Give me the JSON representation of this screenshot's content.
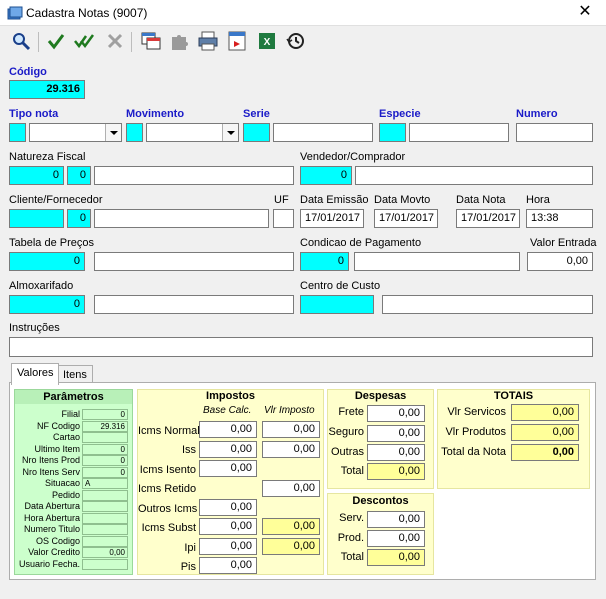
{
  "window": {
    "title": "Cadastra Notas (9007)",
    "close_glyph": "✕"
  },
  "toolbar": {
    "icons": [
      "search-icon",
      "check-icon",
      "check-all-icon",
      "cancel-icon",
      "copy-window-icon",
      "puzzle-icon",
      "print-icon",
      "pdf-icon",
      "excel-icon",
      "history-icon"
    ]
  },
  "header": {
    "codigo_label": "Código",
    "codigo_value": "29.316",
    "tipo_nota_label": "Tipo nota",
    "movimento_label": "Movimento",
    "serie_label": "Serie",
    "especie_label": "Especie",
    "numero_label": "Numero"
  },
  "natureza": {
    "label": "Natureza Fiscal",
    "code1": "0",
    "code2": "0"
  },
  "vendedor": {
    "label": "Vendedor/Comprador",
    "code": "0"
  },
  "cliente": {
    "label": "Cliente/Fornecedor",
    "code": "0",
    "uf_label": "UF"
  },
  "datas": {
    "emissao_label": "Data Emissão",
    "emissao_value": "17/01/2017",
    "movto_label": "Data Movto",
    "movto_value": "17/01/2017",
    "nota_label": "Data Nota",
    "nota_value": "17/01/2017",
    "hora_label": "Hora",
    "hora_value": "13:38"
  },
  "tabela": {
    "label": "Tabela de Preços",
    "code": "0"
  },
  "condicao": {
    "label": "Condicao de Pagamento",
    "code": "0"
  },
  "valor_entrada": {
    "label": "Valor Entrada",
    "value": "0,00"
  },
  "almoxarifado": {
    "label": "Almoxarifado",
    "code": "0"
  },
  "centro_custo": {
    "label": "Centro de Custo"
  },
  "instrucoes": {
    "label": "Instruções"
  },
  "tabs": [
    {
      "label": "Valores"
    },
    {
      "label": "Itens"
    }
  ],
  "parametros": {
    "title": "Parâmetros",
    "rows": [
      {
        "label": "Filial",
        "value": "0"
      },
      {
        "label": "NF Codigo",
        "value": "29.316"
      },
      {
        "label": "Cartao",
        "value": ""
      },
      {
        "label": "Ultimo Item",
        "value": "0"
      },
      {
        "label": "Nro Itens Prod",
        "value": "0"
      },
      {
        "label": "Nro Itens Serv",
        "value": "0"
      },
      {
        "label": "Situacao",
        "value": "A"
      },
      {
        "label": "Pedido",
        "value": ""
      },
      {
        "label": "Data Abertura",
        "value": ""
      },
      {
        "label": "Hora Abertura",
        "value": ""
      },
      {
        "label": "Numero Titulo",
        "value": ""
      },
      {
        "label": "OS Codigo",
        "value": ""
      },
      {
        "label": "Valor Credito",
        "value": "0,00"
      },
      {
        "label": "Usuario Fecha.",
        "value": ""
      }
    ]
  },
  "impostos": {
    "title": "Impostos",
    "col1": "Base Calc.",
    "col2": "Vlr Imposto",
    "icms_normal_label": "Icms Normal",
    "icms_normal_base": "0,00",
    "icms_normal_vlr": "0,00",
    "iss_label": "Iss",
    "iss_base": "0,00",
    "iss_vlr": "0,00",
    "icms_isento_label": "Icms Isento",
    "icms_isento_base": "0,00",
    "icms_retido_label": "Icms Retido",
    "icms_retido_vlr": "0,00",
    "outros_icms_label": "Outros Icms",
    "outros_icms_base": "0,00",
    "icms_subst_label": "Icms Subst",
    "icms_subst_base": "0,00",
    "icms_subst_vlr": "0,00",
    "ipi_label": "Ipi",
    "ipi_base": "0,00",
    "ipi_vlr": "0,00",
    "pis_label": "Pis",
    "pis_base": "0,00"
  },
  "despesas": {
    "title": "Despesas",
    "frete_label": "Frete",
    "frete_value": "0,00",
    "seguro_label": "Seguro",
    "seguro_value": "0,00",
    "outras_label": "Outras",
    "outras_value": "0,00",
    "total_label": "Total",
    "total_value": "0,00"
  },
  "descontos": {
    "title": "Descontos",
    "serv_label": "Serv.",
    "serv_value": "0,00",
    "prod_label": "Prod.",
    "prod_value": "0,00",
    "total_label": "Total",
    "total_value": "0,00"
  },
  "totais": {
    "title": "TOTAIS",
    "servicos_label": "Vlr Servicos",
    "servicos_value": "0,00",
    "produtos_label": "Vlr Produtos",
    "produtos_value": "0,00",
    "nota_label": "Total da Nota",
    "nota_value": "0,00"
  },
  "colors": {
    "cyan": "#00ffff",
    "label_blue": "#1b1bc8",
    "green_panel": "#ccffcc",
    "yellow_panel": "#ffffcc",
    "yellow_field": "#ffff99"
  }
}
